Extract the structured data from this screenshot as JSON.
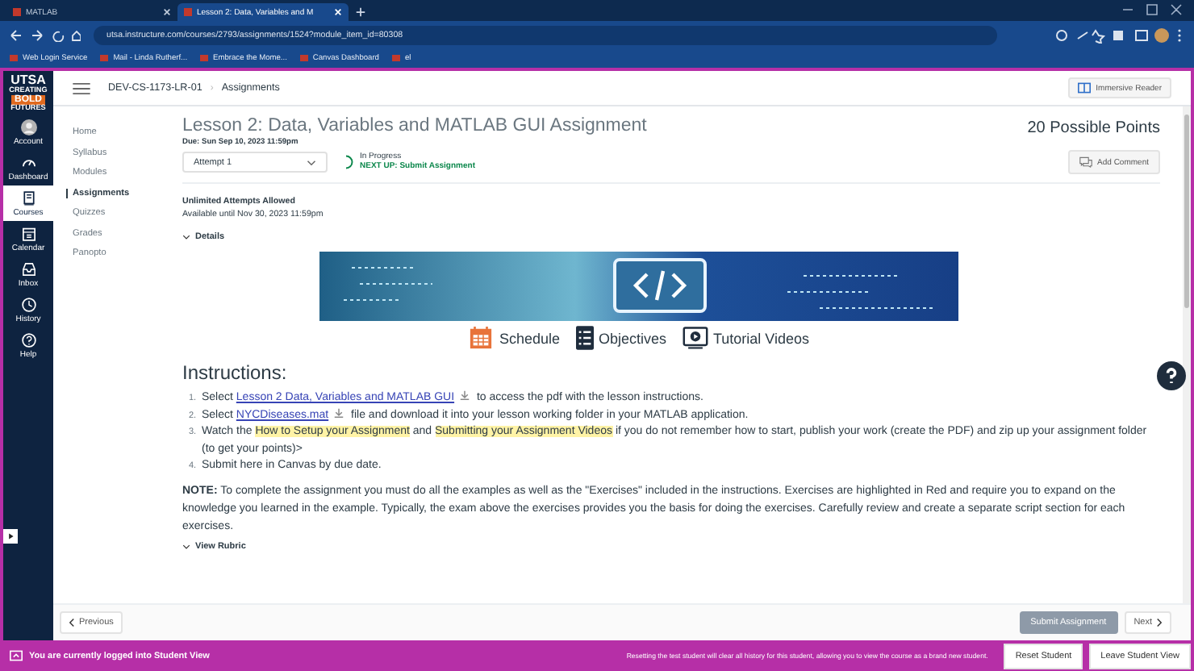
{
  "browser": {
    "tabs": [
      {
        "title": "MATLAB",
        "selected": false
      },
      {
        "title": "Lesson 2: Data, Variables and M",
        "selected": true
      }
    ],
    "url": "utsa.instructure.com/courses/2793/assignments/1524?module_item_id=80308",
    "bookmarks": [
      "Web Login Service",
      "Mail - Linda Rutherf...",
      "Embrace the Mome...",
      "Canvas Dashboard",
      "el"
    ]
  },
  "global_nav": {
    "logo": [
      "UTSA",
      "CREATING",
      "BOLD",
      "FUTURES"
    ],
    "items": [
      {
        "kind": "account",
        "label": "Account",
        "selected": false
      },
      {
        "kind": "dashboard",
        "label": "Dashboard",
        "selected": false
      },
      {
        "kind": "courses",
        "label": "Courses",
        "selected": true
      },
      {
        "kind": "calendar",
        "label": "Calendar",
        "selected": false
      },
      {
        "kind": "inbox",
        "label": "Inbox",
        "selected": false
      },
      {
        "kind": "history",
        "label": "History",
        "selected": false
      },
      {
        "kind": "help",
        "label": "Help",
        "selected": false
      }
    ]
  },
  "breadcrumb": [
    "DEV-CS-1173-LR-01",
    "Assignments"
  ],
  "breadcrumb_separator": "›",
  "immersive_reader": "Immersive Reader",
  "course_nav": [
    {
      "label": "Home",
      "selected": false
    },
    {
      "label": "Syllabus",
      "selected": false
    },
    {
      "label": "Modules",
      "selected": false
    },
    {
      "label": "Assignments",
      "selected": true
    },
    {
      "label": "Quizzes",
      "selected": false
    },
    {
      "label": "Grades",
      "selected": false
    },
    {
      "label": "Panopto",
      "selected": false
    }
  ],
  "assignment": {
    "title": "Lesson 2: Data, Variables and MATLAB GUI Assignment",
    "due": "Due: Sun Sep 10, 2023 11:59pm",
    "attempt": "Attempt 1",
    "status": "In Progress",
    "next_up": "NEXT UP: Submit Assignment",
    "points": "20 Possible Points",
    "add_comment": "Add Comment",
    "attempts_allowed": "Unlimited Attempts Allowed",
    "available": "Available until Nov 30, 2023 11:59pm",
    "details": "Details"
  },
  "banner_links": [
    {
      "kind": "calendar",
      "label": "Schedule"
    },
    {
      "kind": "list",
      "label": "Objectives"
    },
    {
      "kind": "video",
      "label": "Tutorial Videos"
    }
  ],
  "instructions": {
    "heading": "Instructions:",
    "numbers": [
      "1.",
      "2.",
      "3.",
      "4."
    ],
    "items": [
      [
        {
          "kind": "text",
          "text": "Select "
        },
        {
          "kind": "download",
          "text": "Lesson 2 Data, Variables and MATLAB GUI"
        },
        {
          "kind": "text",
          "text": " to access the pdf with the lesson instructions."
        }
      ],
      [
        {
          "kind": "text",
          "text": "Select "
        },
        {
          "kind": "download",
          "text": "NYCDiseases.mat"
        },
        {
          "kind": "text",
          "text": " file and download it into your lesson working folder in your MATLAB application."
        }
      ],
      [
        {
          "kind": "text",
          "text": "Watch the "
        },
        {
          "kind": "highlight",
          "text": "How to Setup your Assignment"
        },
        {
          "kind": "text",
          "text": " and "
        },
        {
          "kind": "highlight",
          "text": "Submitting your Assignment Videos"
        },
        {
          "kind": "text",
          "text": " if you do not remember how to start, publish your work (create the PDF) and zip up your assignment folder (to get your points)>"
        }
      ],
      [
        {
          "kind": "text",
          "text": "Submit here in Canvas by due date."
        }
      ]
    ],
    "note": "**NOTE:** To complete the assignment you must do all the examples as well as the \"Exercises\" included in the instructions. Exercises are highlighted in Red and require you to expand on the knowledge you learned in the example.  Typically, the exam above the exercises provides you the basis for doing the exercises. Carefully review and create a separate script section for each exercises."
  },
  "view_rubric": "View Rubric",
  "footer_nav": {
    "previous": "Previous",
    "submit": "Submit Assignment",
    "next": "Next"
  },
  "student_view": {
    "message": "You are currently logged into Student View",
    "warning": "Resetting the test student will clear all history for this student, allowing you to view the course as a brand new student.",
    "reset": "Reset Student",
    "leave": "Leave Student View"
  }
}
